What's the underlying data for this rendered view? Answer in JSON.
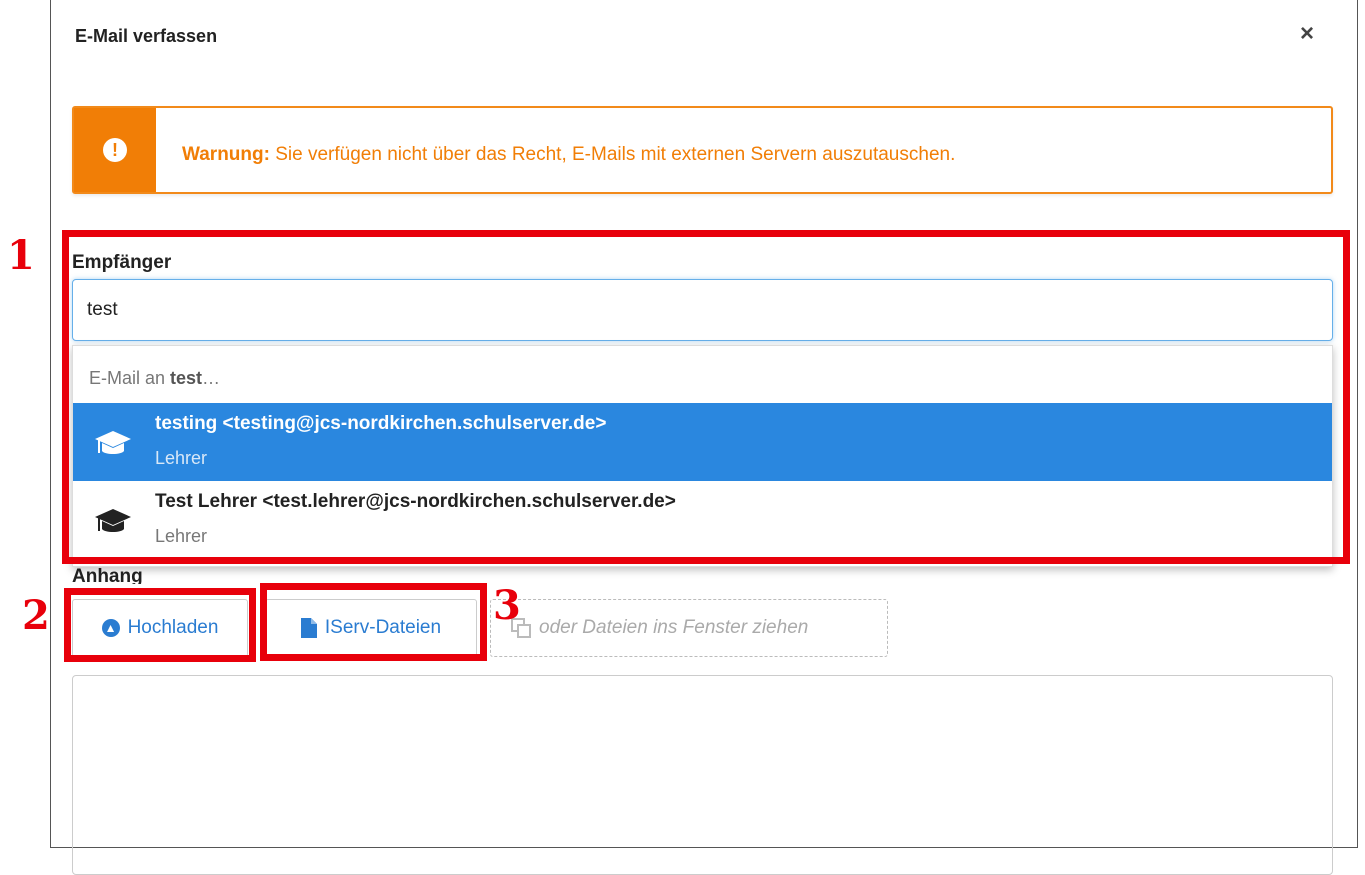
{
  "dialog": {
    "title": "E-Mail verfassen",
    "close_label": "×"
  },
  "alert": {
    "icon": "exclamation-icon",
    "bold": "Warnung:",
    "text": " Sie verfügen nicht über das Recht, E-Mails mit externen Servern auszutauschen.",
    "color": "#f17e06"
  },
  "recipients": {
    "label": "Empfänger",
    "value": "test",
    "dropdown": {
      "prefix": "E-Mail an ",
      "query": "test",
      "suffix": "…",
      "items": [
        {
          "icon": "graduation-cap-icon",
          "name": "testing <testing@jcs-nordkirchen.schulserver.de>",
          "role": "Lehrer",
          "active": true
        },
        {
          "icon": "graduation-cap-icon",
          "name": "Test Lehrer <test.lehrer@jcs-nordkirchen.schulserver.de>",
          "role": "Lehrer",
          "active": false
        }
      ]
    }
  },
  "attachment": {
    "label": "Anhang",
    "upload_icon": "arrow-circle-up-icon",
    "upload_label": "Hochladen",
    "iserv_icon": "file-icon",
    "iserv_label": "IServ-Dateien",
    "drop_icon": "copy-icon",
    "drop_label": "oder Dateien ins Fenster ziehen"
  },
  "annotations": {
    "colors": {
      "highlight": "#e8000b",
      "accent": "#2a87df"
    },
    "markers": [
      "1",
      "2",
      "3"
    ]
  }
}
